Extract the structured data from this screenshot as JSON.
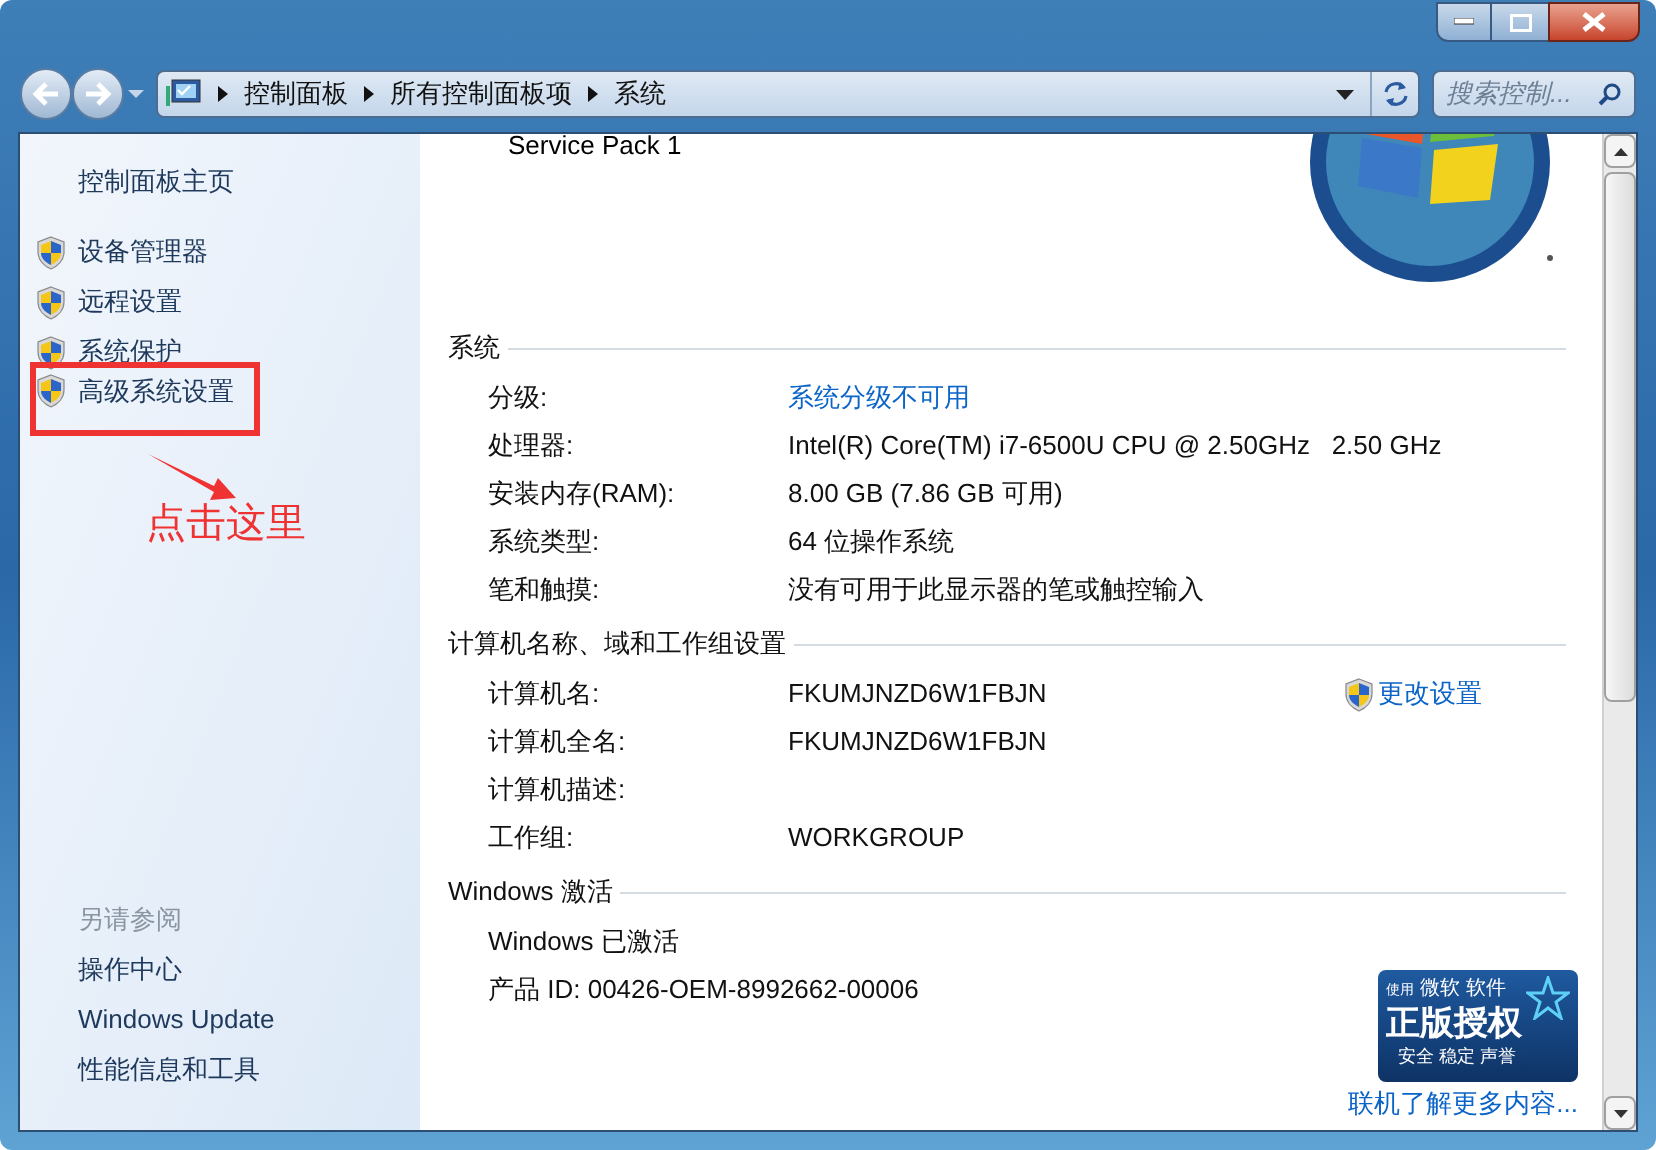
{
  "address_bar": {
    "breadcrumbs": [
      "控制面板",
      "所有控制面板项",
      "系统"
    ]
  },
  "search": {
    "placeholder": "搜索控制..."
  },
  "sidebar": {
    "home": "控制面板主页",
    "items": [
      {
        "label": "设备管理器",
        "highlighted": false
      },
      {
        "label": "远程设置",
        "highlighted": false
      },
      {
        "label": "系统保护",
        "highlighted": false
      },
      {
        "label": "高级系统设置",
        "highlighted": true
      }
    ],
    "annotation": "点击这里",
    "see_also": {
      "title": "另请参阅",
      "links": [
        "操作中心",
        "Windows Update",
        "性能信息和工具"
      ]
    }
  },
  "main": {
    "top_text": "Service Pack 1",
    "sections": [
      {
        "title": "系统",
        "rows": [
          {
            "label": "分级:",
            "value": "系统分级不可用",
            "kind": "link"
          },
          {
            "label": "处理器:",
            "value": "Intel(R) Core(TM) i7-6500U CPU @ 2.50GHz   2.50 GHz",
            "kind": "text"
          },
          {
            "label": "安装内存(RAM):",
            "value": "8.00 GB (7.86 GB 可用)",
            "kind": "text"
          },
          {
            "label": "系统类型:",
            "value": "64 位操作系统",
            "kind": "text"
          },
          {
            "label": "笔和触摸:",
            "value": "没有可用于此显示器的笔或触控输入",
            "kind": "text"
          }
        ]
      },
      {
        "title": "计算机名称、域和工作组设置",
        "action": "更改设置",
        "rows": [
          {
            "label": "计算机名:",
            "value": "FKUMJNZD6W1FBJN",
            "kind": "text"
          },
          {
            "label": "计算机全名:",
            "value": "FKUMJNZD6W1FBJN",
            "kind": "text"
          },
          {
            "label": "计算机描述:",
            "value": "",
            "kind": "text"
          },
          {
            "label": "工作组:",
            "value": "WORKGROUP",
            "kind": "text"
          }
        ]
      },
      {
        "title": "Windows 激活",
        "rows": [
          {
            "label": "Windows 已激活",
            "kind": "full"
          },
          {
            "label": "产品 ID: 00426-OEM-8992662-00006",
            "kind": "full"
          }
        ]
      }
    ],
    "badge": {
      "small": "使用",
      "brand": "微软",
      "suffix": "软件",
      "main": "正版授权",
      "tagline": "安全 稳定 声誉"
    },
    "more_link": "联机了解更多内容..."
  }
}
